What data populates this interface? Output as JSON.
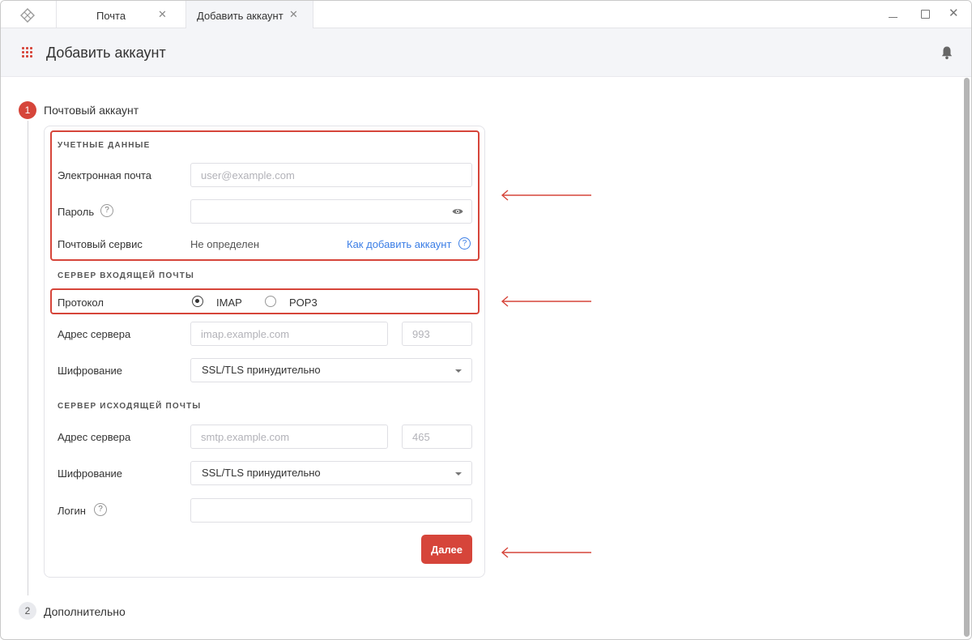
{
  "tabs": [
    {
      "label": "Почта",
      "close": "✕"
    },
    {
      "label": "Добавить аккаунт",
      "close": "✕"
    }
  ],
  "window_controls": {
    "close": "✕"
  },
  "header": {
    "title": "Добавить аккаунт"
  },
  "steps": [
    {
      "number": "1",
      "label": "Почтовый аккаунт"
    },
    {
      "number": "2",
      "label": "Дополнительно"
    }
  ],
  "credentials": {
    "section_title": "УЧЕТНЫЕ ДАННЫЕ",
    "email_label": "Электронная почта",
    "email_placeholder": "user@example.com",
    "password_label": "Пароль",
    "help_glyph": "?",
    "mail_service_label": "Почтовый сервис",
    "mail_service_value": "Не определен",
    "how_to_link": "Как добавить аккаунт"
  },
  "incoming": {
    "section_title": "СЕРВЕР ВХОДЯЩЕЙ ПОЧТЫ",
    "protocol_label": "Протокол",
    "protocol_options": [
      "IMAP",
      "POP3"
    ],
    "protocol_selected": "IMAP",
    "server_label": "Адрес сервера",
    "server_placeholder": "imap.example.com",
    "port_placeholder": "993",
    "encryption_label": "Шифрование",
    "encryption_value": "SSL/TLS принудительно"
  },
  "outgoing": {
    "section_title": "СЕРВЕР ИСХОДЯЩЕЙ ПОЧТЫ",
    "server_label": "Адрес сервера",
    "server_placeholder": "smtp.example.com",
    "port_placeholder": "465",
    "encryption_label": "Шифрование",
    "encryption_value": "SSL/TLS принудительно",
    "login_label": "Логин"
  },
  "actions": {
    "next_label": "Далее"
  },
  "colors": {
    "accent": "#d6453a",
    "link": "#3b7ee6",
    "header_bg": "#f4f5f8"
  }
}
